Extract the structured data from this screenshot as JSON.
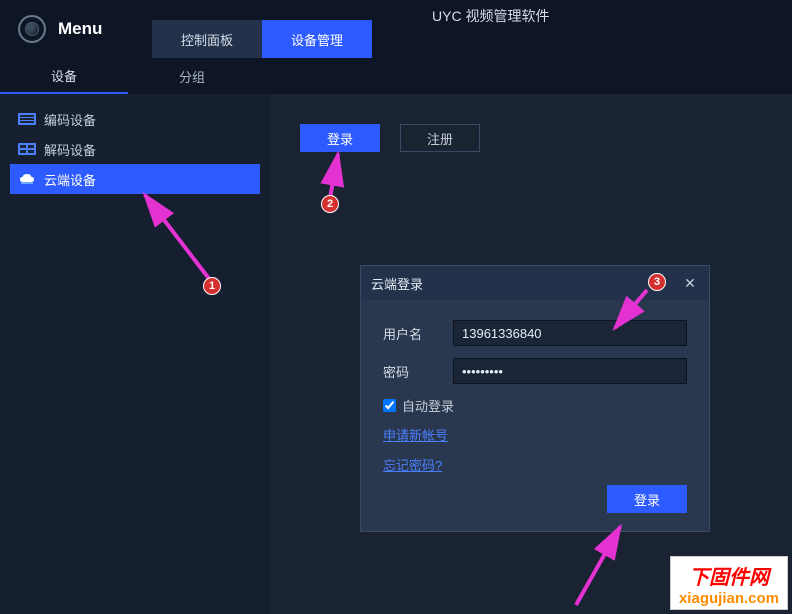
{
  "app": {
    "title": "UYC 视频管理软件",
    "menu_label": "Menu"
  },
  "top_tabs": [
    {
      "label": "控制面板",
      "active": false
    },
    {
      "label": "设备管理",
      "active": true
    }
  ],
  "sub_tabs": [
    {
      "label": "设备",
      "active": true
    },
    {
      "label": "分组",
      "active": false
    }
  ],
  "sidebar": {
    "items": [
      {
        "label": "编码设备",
        "icon": "encoder-icon",
        "active": false
      },
      {
        "label": "解码设备",
        "icon": "decoder-icon",
        "active": false
      },
      {
        "label": "云端设备",
        "icon": "cloud-icon",
        "active": true
      }
    ]
  },
  "content": {
    "login_btn": "登录",
    "register_btn": "注册"
  },
  "dialog": {
    "title": "云端登录",
    "username_label": "用户名",
    "username_value": "13961336840",
    "password_label": "密码",
    "password_value": "•••••••••",
    "auto_login_label": "自动登录",
    "auto_login_checked": true,
    "apply_account_link": "申请新帐号",
    "forgot_password_link": "忘记密码?",
    "submit_label": "登录"
  },
  "annotations": {
    "n1": "1",
    "n2": "2",
    "n3": "3"
  },
  "watermark": {
    "cn": "下固件网",
    "en": "xiagujian.com"
  }
}
